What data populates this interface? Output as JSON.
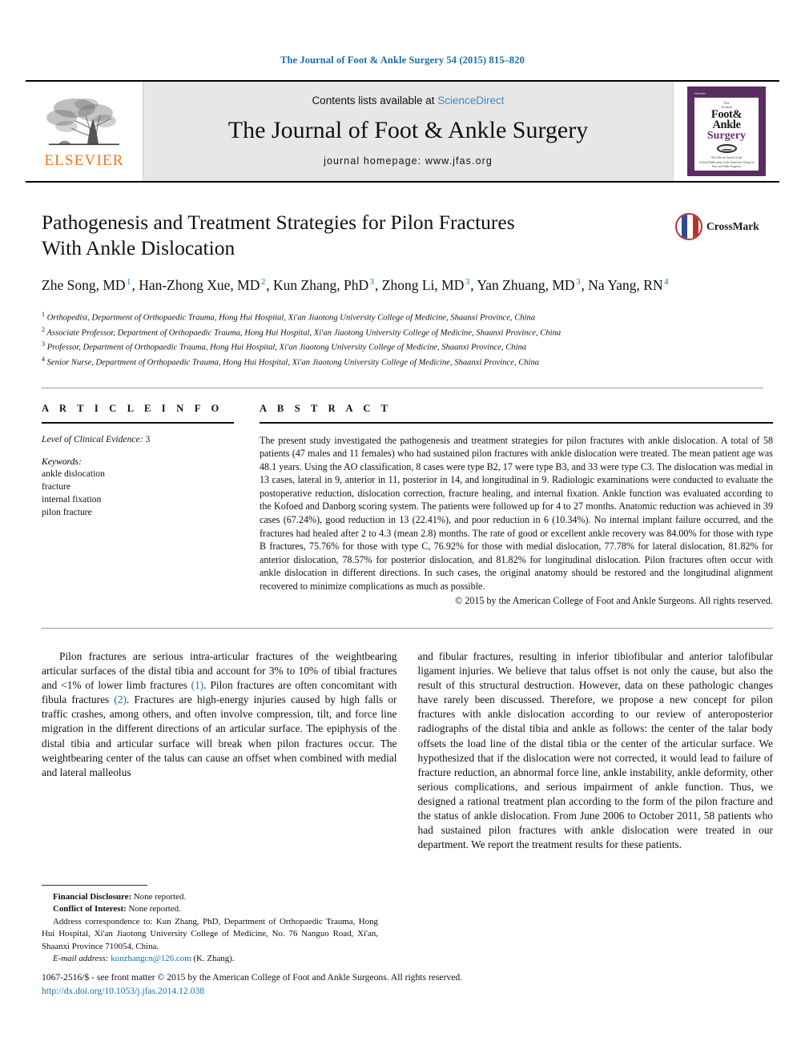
{
  "running_head": "The Journal of Foot & Ankle Surgery 54 (2015) 815–820",
  "masthead": {
    "publisher_logo_word": "ELSEVIER",
    "contents_prefix": "Contents lists available at ",
    "contents_link": "ScienceDirect",
    "journal_title": "The Journal of Foot & Ankle Surgery",
    "homepage": "journal homepage: www.jfas.org",
    "cover": {
      "top_strip": "Number",
      "line_the": "The",
      "line_journal": "Journal",
      "line_of": "of",
      "line_foot": "Foot&",
      "line_ankle": "Ankle",
      "line_surgery": "Surgery",
      "seal_caption": "The Official Journal of the",
      "footer": "Official Publication of the\nAmerican College of Foot and Ankle Surgeons"
    }
  },
  "article": {
    "title": "Pathogenesis and Treatment Strategies for Pilon Fractures With Ankle Dislocation",
    "title_line1": "Pathogenesis and Treatment Strategies for Pilon Fractures",
    "title_line2": "With Ankle Dislocation",
    "crossmark_label": "CrossMark",
    "authors": [
      {
        "name": "Zhe Song, MD",
        "sup": "1"
      },
      {
        "name": "Han-Zhong Xue, MD",
        "sup": "2"
      },
      {
        "name": "Kun Zhang, PhD",
        "sup": "3"
      },
      {
        "name": "Zhong Li, MD",
        "sup": "3"
      },
      {
        "name": "Yan Zhuang, MD",
        "sup": "3"
      },
      {
        "name": "Na Yang, RN",
        "sup": "4"
      }
    ],
    "affiliations": [
      {
        "idx": "1",
        "text": "Orthopedist, Department of Orthopaedic Trauma, Hong Hui Hospital, Xi'an Jiaotong University College of Medicine, Shaanxi Province, China"
      },
      {
        "idx": "2",
        "text": "Associate Professor, Department of Orthopaedic Trauma, Hong Hui Hospital, Xi'an Jiaotong University College of Medicine, Shaanxi Province, China"
      },
      {
        "idx": "3",
        "text": "Professor, Department of Orthopaedic Trauma, Hong Hui Hospital, Xi'an Jiaotong University College of Medicine, Shaanxi Province, China"
      },
      {
        "idx": "4",
        "text": "Senior Nurse, Department of Orthopaedic Trauma, Hong Hui Hospital, Xi'an Jiaotong University College of Medicine, Shaanxi Province, China"
      }
    ]
  },
  "article_info": {
    "heading": "A R T I C L E   I N F O",
    "level_label": "Level of Clinical Evidence:",
    "level_value": "3",
    "keywords_label": "Keywords:",
    "keywords": [
      "ankle dislocation",
      "fracture",
      "internal fixation",
      "pilon fracture"
    ]
  },
  "abstract": {
    "heading": "A B S T R A C T",
    "text": "The present study investigated the pathogenesis and treatment strategies for pilon fractures with ankle dislocation. A total of 58 patients (47 males and 11 females) who had sustained pilon fractures with ankle dislocation were treated. The mean patient age was 48.1 years. Using the AO classification, 8 cases were type B2, 17 were type B3, and 33 were type C3. The dislocation was medial in 13 cases, lateral in 9, anterior in 11, posterior in 14, and longitudinal in 9. Radiologic examinations were conducted to evaluate the postoperative reduction, dislocation correction, fracture healing, and internal fixation. Ankle function was evaluated according to the Kofoed and Danborg scoring system. The patients were followed up for 4 to 27 months. Anatomic reduction was achieved in 39 cases (67.24%), good reduction in 13 (22.41%), and poor reduction in 6 (10.34%). No internal implant failure occurred, and the fractures had healed after 2 to 4.3 (mean 2.8) months. The rate of good or excellent ankle recovery was 84.00% for those with type B fractures, 75.76% for those with type C, 76.92% for those with medial dislocation, 77.78% for lateral dislocation, 81.82% for anterior dislocation, 78.57% for posterior dislocation, and 81.82% for longitudinal dislocation. Pilon fractures often occur with ankle dislocation in different directions. In such cases, the original anatomy should be restored and the longitudinal alignment recovered to minimize complications as much as possible.",
    "copyright": "© 2015 by the American College of Foot and Ankle Surgeons. All rights reserved."
  },
  "body": {
    "left_column": {
      "part1": "Pilon fractures are serious intra-articular fractures of the weightbearing articular surfaces of the distal tibia and account for 3% to 10% of tibial fractures and <1% of lower limb fractures ",
      "ref1": "(1)",
      "part2": ". Pilon fractures are often concomitant with fibula fractures ",
      "ref2": "(2)",
      "part3": ". Fractures are high-energy injuries caused by high falls or traffic crashes, among others, and often involve compression, tilt, and force line migration in the different directions of an articular surface. The epiphysis of the distal tibia and articular surface will break when pilon fractures occur. The weightbearing center of the talus can cause an offset when combined with medial and lateral malleolus"
    },
    "right_column": {
      "text": "and fibular fractures, resulting in inferior tibiofibular and anterior talofibular ligament injuries. We believe that talus offset is not only the cause, but also the result of this structural destruction. However, data on these pathologic changes have rarely been discussed. Therefore, we propose a new concept for pilon fractures with ankle dislocation according to our review of anteroposterior radiographs of the distal tibia and ankle as follows: the center of the talar body offsets the load line of the distal tibia or the center of the articular surface. We hypothesized that if the dislocation were not corrected, it would lead to failure of fracture reduction, an abnormal force line, ankle instability, ankle deformity, other serious complications, and serious impairment of ankle function. Thus, we designed a rational treatment plan according to the form of the pilon fracture and the status of ankle dislocation. From June 2006 to October 2011, 58 patients who had sustained pilon fractures with ankle dislocation were treated in our department. We report the treatment results for these patients."
    }
  },
  "footnotes": {
    "financial_label": "Financial Disclosure:",
    "financial_value": " None reported.",
    "conflict_label": "Conflict of Interest:",
    "conflict_value": " None reported.",
    "address_label": "Address correspondence to:",
    "address_value": " Kun Zhang, PhD, Department of Orthopaedic Trauma, Hong Hui Hospital, Xi'an Jiaotong University College of Medicine, No. 76 Nanguo Road, Xi'an, Shaanxi Province 710054, China.",
    "email_label": "E-mail address:",
    "email_value": "kunzhangcn@126.com",
    "email_suffix": " (K. Zhang)."
  },
  "imprint": {
    "issn_line": "1067-2516/$ - see front matter © 2015 by the American College of Foot and Ankle Surgeons. All rights reserved.",
    "doi": "http://dx.doi.org/10.1053/j.jfas.2014.12.038"
  },
  "colors": {
    "link_blue": "#1a6ea8",
    "sciencedirect_blue": "#3a8cc8",
    "elsevier_orange": "#E87722",
    "cover_purple": "#5b2d63",
    "masthead_gray": "#e7e7e7"
  }
}
